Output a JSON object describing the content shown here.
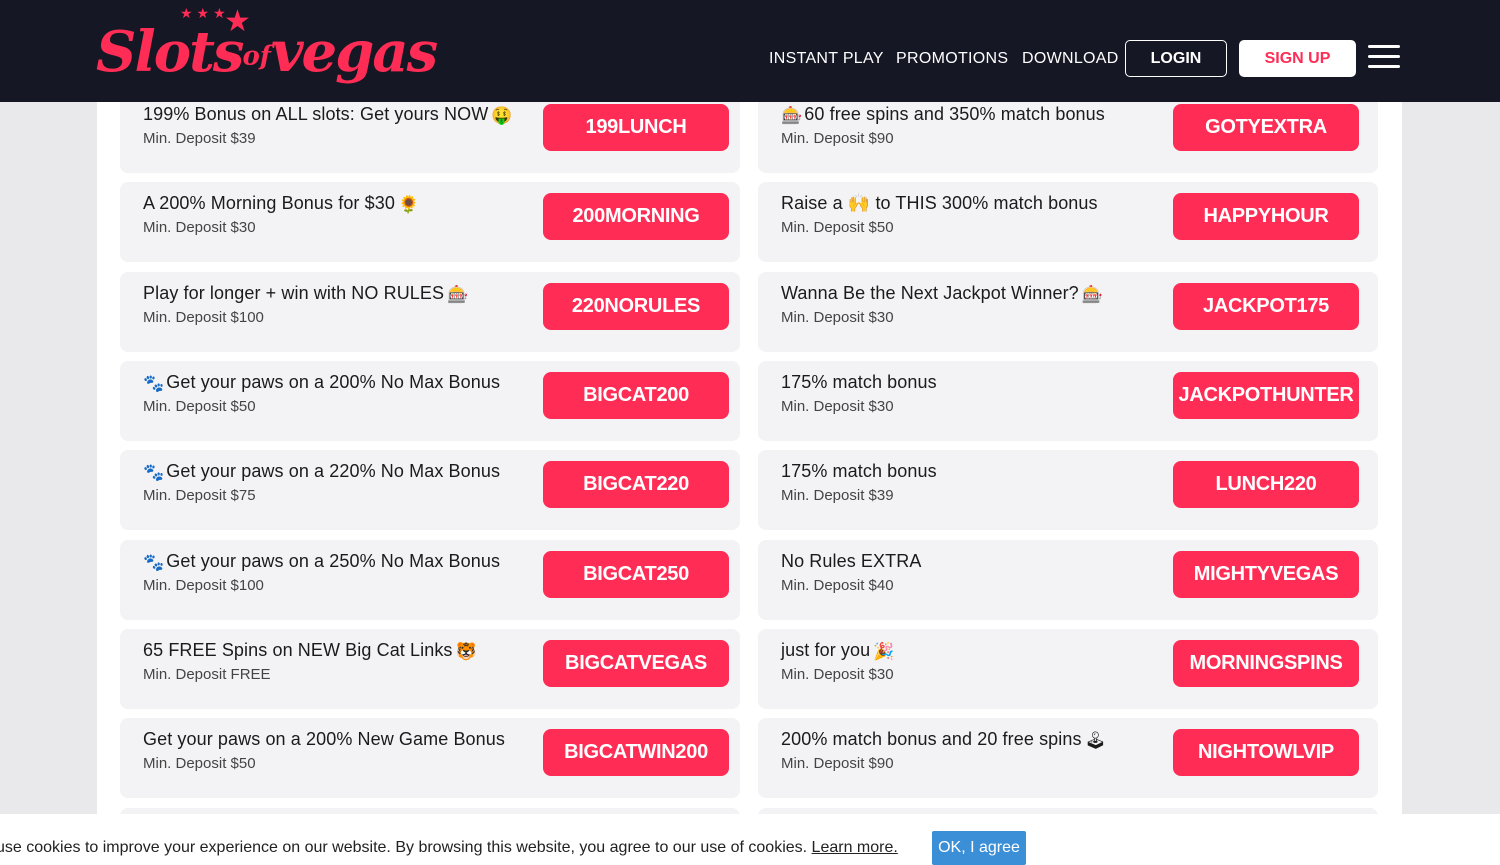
{
  "header": {
    "logo": {
      "word1": "Slots",
      "word2": "of",
      "word3": "vegas"
    },
    "nav": [
      "INSTANT PLAY",
      "PROMOTIONS",
      "DOWNLOAD"
    ],
    "login_label": "LOGIN",
    "signup_label": "SIGN UP",
    "menu_icon": "hamburger-menu-icon"
  },
  "promos_left": [
    {
      "title": "199% Bonus on ALL slots: Get yours NOW",
      "emoji_after": "🤑",
      "emoji_before": "",
      "min": "Min. Deposit $39",
      "code": "199LUNCH"
    },
    {
      "title": "A 200% Morning Bonus for $30",
      "emoji_after": "🌻",
      "emoji_before": "",
      "min": "Min. Deposit $30",
      "code": "200MORNING"
    },
    {
      "title": "Play for longer + win with NO RULES",
      "emoji_after": "🎰",
      "emoji_before": "",
      "min": "Min. Deposit $100",
      "code": "220NORULES"
    },
    {
      "title": "Get your paws on a 200% No Max Bonus",
      "emoji_after": "",
      "emoji_before": "🐾",
      "min": "Min. Deposit $50",
      "code": "BIGCAT200"
    },
    {
      "title": "Get your paws on a 220% No Max Bonus",
      "emoji_after": "",
      "emoji_before": "🐾",
      "min": "Min. Deposit $75",
      "code": "BIGCAT220"
    },
    {
      "title": "Get your paws on a 250% No Max Bonus",
      "emoji_after": "",
      "emoji_before": "🐾",
      "min": "Min. Deposit $100",
      "code": "BIGCAT250"
    },
    {
      "title": "65 FREE Spins on NEW Big Cat Links",
      "emoji_after": "🐯",
      "emoji_before": "",
      "min": "Min. Deposit FREE",
      "code": "BIGCATVEGAS"
    },
    {
      "title": "Get your paws on a 200% New Game Bonus",
      "emoji_after": "",
      "emoji_before": "",
      "min": "Min. Deposit $50",
      "code": "BIGCATWIN200"
    }
  ],
  "promos_right": [
    {
      "title": "60 free spins and 350% match bonus",
      "emoji_after": "",
      "emoji_before": "🎰",
      "min": "Min. Deposit $90",
      "code": "GOTYEXTRA"
    },
    {
      "title": "Raise a 🙌 to THIS 300% match bonus",
      "emoji_after": "",
      "emoji_before": "",
      "min": "Min. Deposit $50",
      "code": "HAPPYHOUR"
    },
    {
      "title": "Wanna Be the Next Jackpot Winner?",
      "emoji_after": "🎰",
      "emoji_before": "",
      "min": "Min. Deposit $30",
      "code": "JACKPOT175"
    },
    {
      "title": "175% match bonus",
      "emoji_after": "",
      "emoji_before": "",
      "min": "Min. Deposit $30",
      "code": "JACKPOTHUNTER"
    },
    {
      "title": "175% match bonus",
      "emoji_after": "",
      "emoji_before": "",
      "min": "Min. Deposit $39",
      "code": "LUNCH220"
    },
    {
      "title": "No Rules EXTRA",
      "emoji_after": "",
      "emoji_before": "",
      "min": "Min. Deposit $40",
      "code": "MIGHTYVEGAS"
    },
    {
      "title": "just for you",
      "emoji_after": "🎉",
      "emoji_before": "",
      "min": "Min. Deposit $30",
      "code": "MORNINGSPINS"
    },
    {
      "title": "200% match bonus and 20 free spins",
      "emoji_after": "🕹",
      "emoji_before": "",
      "min": "Min. Deposit $90",
      "code": "NIGHTOWLVIP"
    }
  ],
  "cookie": {
    "text": "use cookies to improve your experience on our website. By browsing this website, you agree to our use of cookies.",
    "link": "Learn more.",
    "button": "OK, I agree"
  },
  "colors": {
    "brand": "#ff2d55",
    "header_bg": "#151724",
    "cookie_button": "#3b8fd6"
  }
}
